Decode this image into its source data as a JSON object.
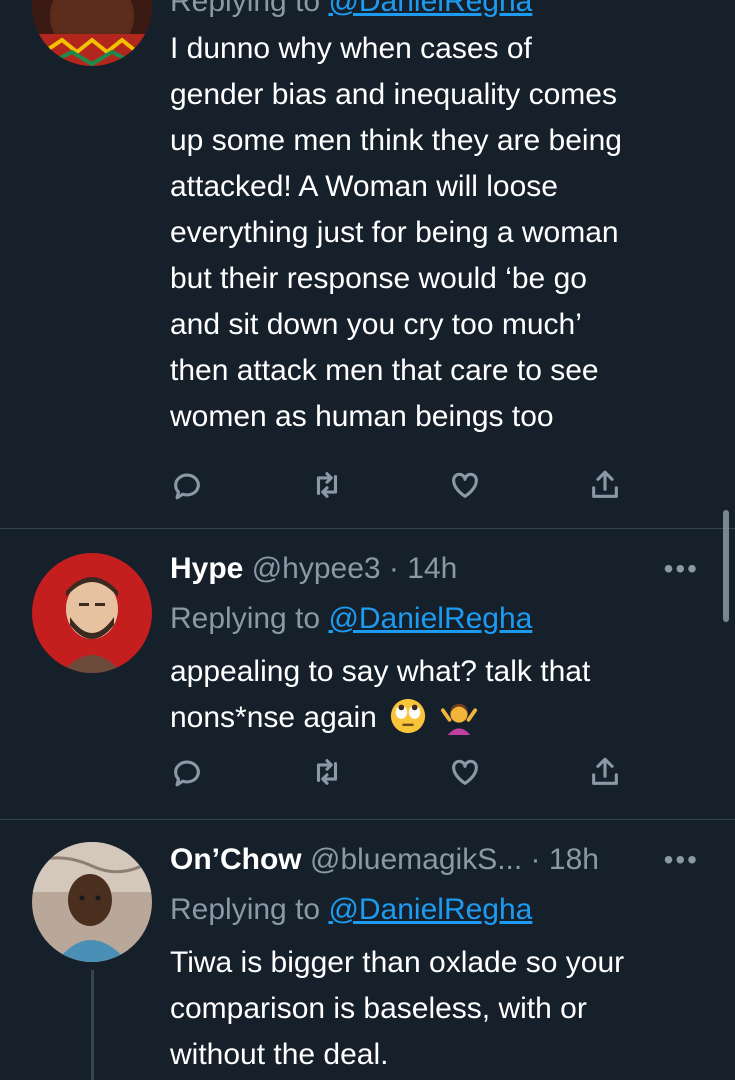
{
  "tweets": [
    {
      "reply_prefix": "Replying to ",
      "reply_handle": "@DanielRegha",
      "lines": [
        "I dunno why when cases of",
        "gender bias and inequality comes",
        "up some men think they are being",
        "attacked! A Woman will loose",
        "everything just for being a woman",
        "but their response would ‘be go",
        "and sit down you cry too much’",
        "then attack men that care to see",
        "women as human beings too"
      ]
    },
    {
      "name": "Hype",
      "handle": "@hypee3",
      "sep": " · ",
      "time": "14h",
      "reply_prefix": "Replying to ",
      "reply_handle": "@DanielRegha",
      "lines": [
        "appealing to say what?  talk that",
        "nons*nse again"
      ],
      "emojis": [
        "face-with-rolling-eyes",
        "person-shrugging"
      ]
    },
    {
      "name": "On’Chow",
      "handle": "@bluemagikS...",
      "sep": " · ",
      "time": "18h",
      "reply_prefix": "Replying to ",
      "reply_handle": "@DanielRegha",
      "lines": [
        "Tiwa is bigger than oxlade so your",
        "comparison is baseless, with or",
        "without the deal."
      ]
    }
  ],
  "more_label": "•••",
  "colors": {
    "background": "#15202b",
    "text": "#ffffff",
    "muted": "#8b98a5",
    "link": "#1d9bf0",
    "divider": "#38444d"
  },
  "icons": [
    "reply-icon",
    "retweet-icon",
    "like-icon",
    "share-icon"
  ]
}
